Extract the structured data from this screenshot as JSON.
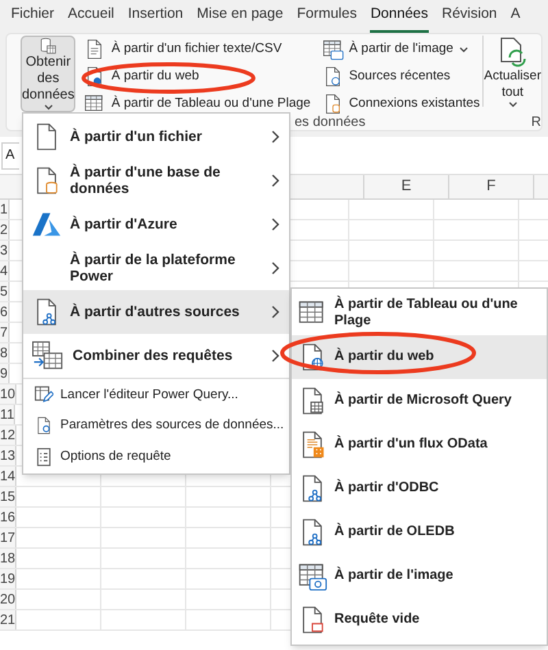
{
  "tabs": [
    {
      "label": "Fichier",
      "selected": false
    },
    {
      "label": "Accueil",
      "selected": false
    },
    {
      "label": "Insertion",
      "selected": false
    },
    {
      "label": "Mise en page",
      "selected": false
    },
    {
      "label": "Formules",
      "selected": false
    },
    {
      "label": "Données",
      "selected": true
    },
    {
      "label": "Révision",
      "selected": false
    },
    {
      "label": "A",
      "selected": false
    }
  ],
  "ribbon": {
    "get_data_button": {
      "label": "Obtenir des données",
      "pressed": true
    },
    "commands_column_1": [
      {
        "label": "À partir d'un fichier texte/CSV",
        "has_dropdown": false
      },
      {
        "label": "À partir du web",
        "has_dropdown": false
      },
      {
        "label": "À partir de Tableau ou d'une Plage",
        "has_dropdown": false
      }
    ],
    "commands_column_2": [
      {
        "label": "À partir de l'image",
        "has_dropdown": true
      },
      {
        "label": "Sources récentes",
        "has_dropdown": false
      },
      {
        "label": "Connexions existantes",
        "has_dropdown": false
      }
    ],
    "group_label": "es données",
    "refresh_button": {
      "label": "Actualiser tout"
    },
    "next_group_label": "R"
  },
  "name_box": "A",
  "columns": [
    "E",
    "F"
  ],
  "rows": [
    "1",
    "2",
    "3",
    "4",
    "5",
    "6",
    "7",
    "8",
    "9",
    "10",
    "11",
    "12",
    "13",
    "14",
    "15",
    "16",
    "17",
    "18",
    "19",
    "20",
    "21"
  ],
  "menu": {
    "items": [
      {
        "label": "À partir d'un fichier",
        "kind": "submenu",
        "selected": false
      },
      {
        "label": "À partir d'une base de données",
        "kind": "submenu",
        "selected": false
      },
      {
        "label": "À partir d'Azure",
        "kind": "submenu",
        "selected": false
      },
      {
        "label": "À partir de la plateforme Power",
        "kind": "submenu",
        "selected": false
      },
      {
        "label": "À partir d'autres sources",
        "kind": "submenu",
        "selected": true
      },
      {
        "label": "Combiner des requêtes",
        "kind": "submenu",
        "selected": false
      },
      {
        "label": "Lancer l'éditeur Power Query...",
        "kind": "command",
        "selected": false
      },
      {
        "label": "Paramètres des sources de données...",
        "kind": "command",
        "selected": false
      },
      {
        "label": "Options de requête",
        "kind": "command",
        "selected": false
      }
    ]
  },
  "submenu": {
    "items": [
      {
        "label": "À partir de Tableau ou d'une Plage",
        "selected": false
      },
      {
        "label": "À partir du web",
        "selected": true
      },
      {
        "label": "À partir de Microsoft Query",
        "selected": false
      },
      {
        "label": "À partir d'un flux OData",
        "selected": false
      },
      {
        "label": "À partir d'ODBC",
        "selected": false
      },
      {
        "label": "À partir de OLEDB",
        "selected": false
      },
      {
        "label": "À partir de l'image",
        "selected": false
      },
      {
        "label": "Requête vide",
        "selected": false
      }
    ]
  }
}
